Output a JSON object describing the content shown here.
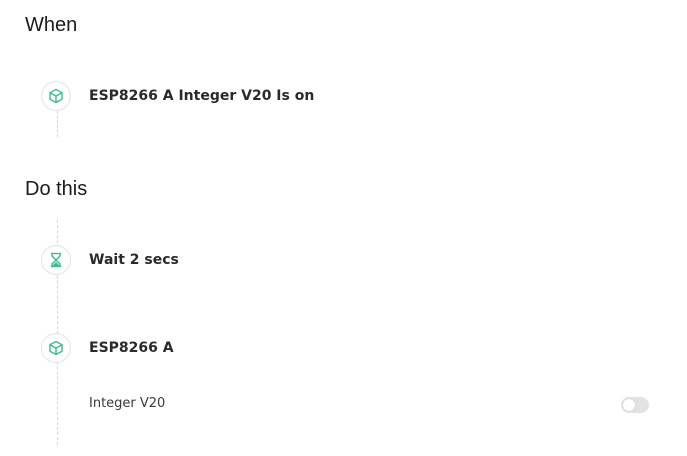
{
  "when": {
    "title": "When",
    "trigger": {
      "label": "ESP8266 A Integer V20 Is on",
      "icon": "cube-icon"
    }
  },
  "do_this": {
    "title": "Do this",
    "steps": [
      {
        "label": "Wait 2 secs",
        "icon": "hourglass-icon"
      },
      {
        "label": "ESP8266 A",
        "icon": "cube-icon",
        "param": {
          "label": "Integer V20",
          "toggle_on": false
        }
      }
    ]
  },
  "colors": {
    "accent": "#3dbd8d",
    "icon_border": "#e3e3e3",
    "dash": "#d6d6d6",
    "toggle_off": "#e2e2e2"
  }
}
